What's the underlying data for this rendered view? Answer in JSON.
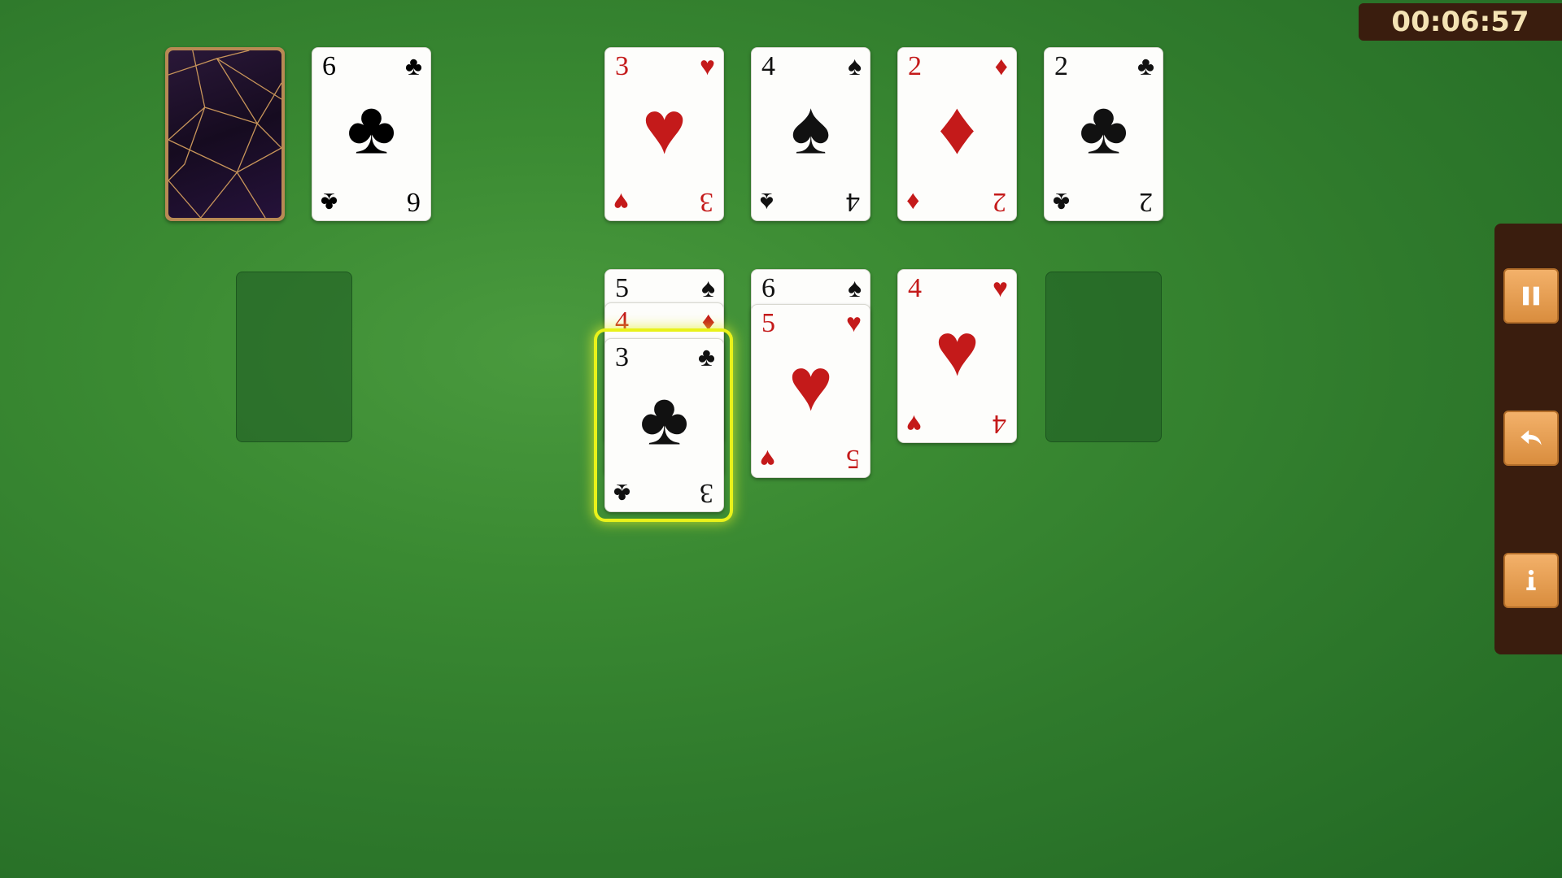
{
  "timer": {
    "text": "00:06:57"
  },
  "stock": {
    "waste_card": {
      "rank": "6",
      "suit": "♣",
      "color": "black"
    }
  },
  "foundations": [
    {
      "rank": "3",
      "suit": "♥",
      "color": "red"
    },
    {
      "rank": "4",
      "suit": "♠",
      "color": "black"
    },
    {
      "rank": "2",
      "suit": "♦",
      "color": "red"
    },
    {
      "rank": "2",
      "suit": "♣",
      "color": "black"
    }
  ],
  "tableau": {
    "col1": [
      {
        "rank": "5",
        "suit": "♠",
        "color": "black"
      },
      {
        "rank": "4",
        "suit": "♦",
        "color": "red"
      },
      {
        "rank": "3",
        "suit": "♣",
        "color": "black"
      }
    ],
    "col2": [
      {
        "rank": "6",
        "suit": "♠",
        "color": "black"
      },
      {
        "rank": "5",
        "suit": "♥",
        "color": "red"
      }
    ],
    "col3": [
      {
        "rank": "4",
        "suit": "♥",
        "color": "red"
      }
    ]
  },
  "side_panel": {
    "buttons": [
      {
        "icon": "pause-icon"
      },
      {
        "icon": "undo-icon"
      },
      {
        "icon": "info-icon"
      }
    ]
  },
  "colors": {
    "felt": "#3a8a32",
    "red_suit": "#c41a1a",
    "black_suit": "#111111",
    "panel": "#3a1d0e",
    "button": "#e89c4f",
    "highlight": "#e9f21a"
  }
}
